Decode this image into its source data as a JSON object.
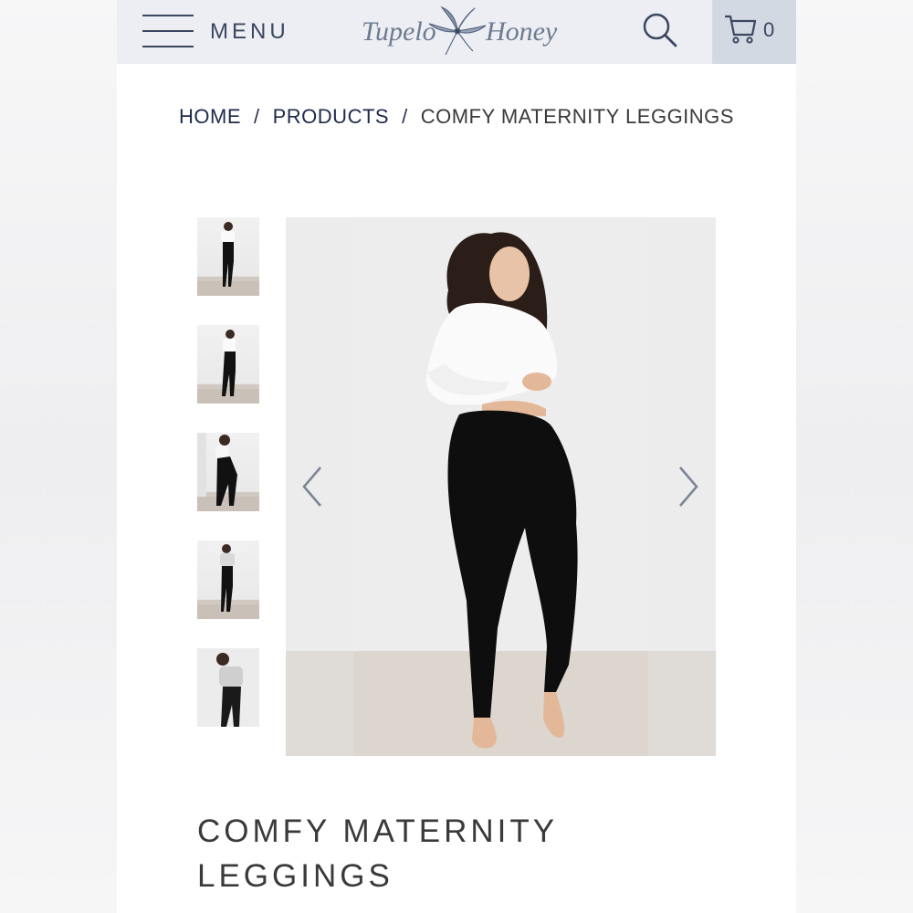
{
  "header": {
    "menu_label": "MENU",
    "logo_left": "Tupelo",
    "logo_right": "Honey",
    "cart_count": "0",
    "icons": [
      "hamburger-icon",
      "search-icon",
      "cart-icon"
    ]
  },
  "breadcrumb": {
    "home": "HOME",
    "separator": "/",
    "products": "PRODUCTS",
    "current": "COMFY MATERNITY LEGGINGS"
  },
  "gallery": {
    "thumbnail_count": 5,
    "prev_icon": "chevron-left-icon",
    "next_icon": "chevron-right-icon"
  },
  "product": {
    "title_line1": "COMFY MATERNITY",
    "title_line2": "LEGGINGS"
  },
  "colors": {
    "header_bg": "#eceef3",
    "cart_bg": "#d3d9e2",
    "nav_text": "#3b4760",
    "link_text": "#1f2a4a"
  }
}
